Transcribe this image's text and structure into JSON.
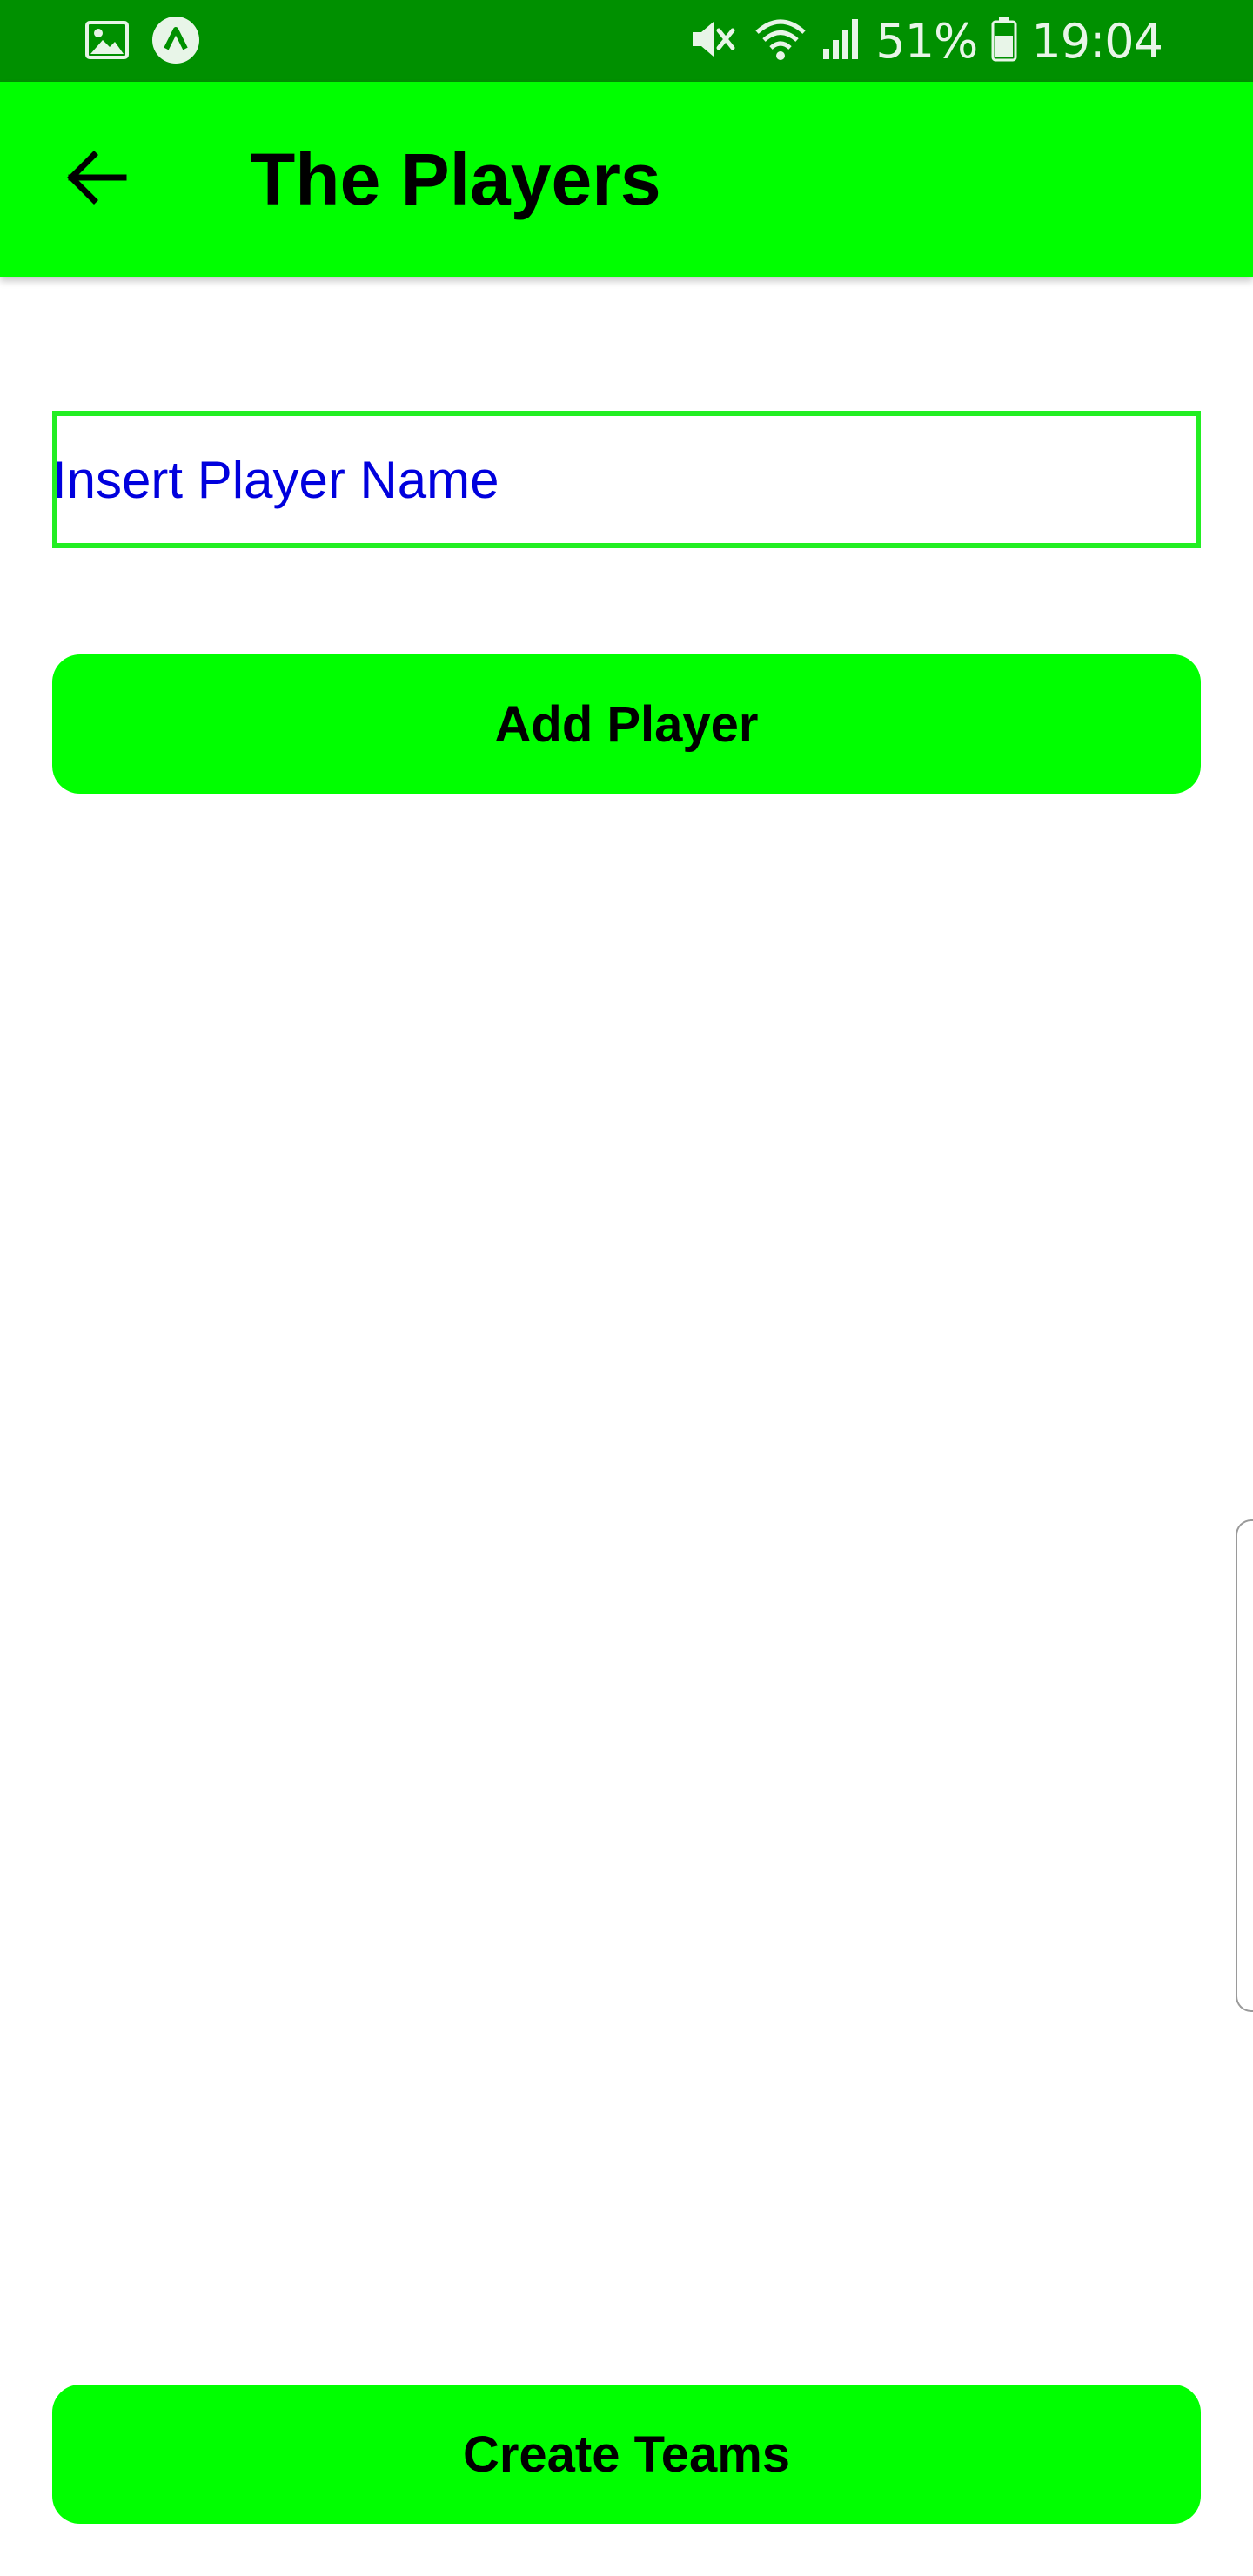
{
  "status_bar": {
    "battery_percent": "51%",
    "time": "19:04",
    "icons": [
      "gallery-icon",
      "app-notification-icon",
      "mute-icon",
      "wifi-icon",
      "signal-icon",
      "battery-icon"
    ]
  },
  "app_bar": {
    "title": "The Players",
    "back_icon": "arrow-left-icon",
    "background_color": "#00ff00"
  },
  "player_input": {
    "placeholder": "Insert Player Name",
    "value": "",
    "border_color": "#22ee22",
    "text_color": "#0000dd"
  },
  "buttons": {
    "add_player_label": "Add Player",
    "create_teams_label": "Create Teams",
    "color": "#00ff00"
  }
}
